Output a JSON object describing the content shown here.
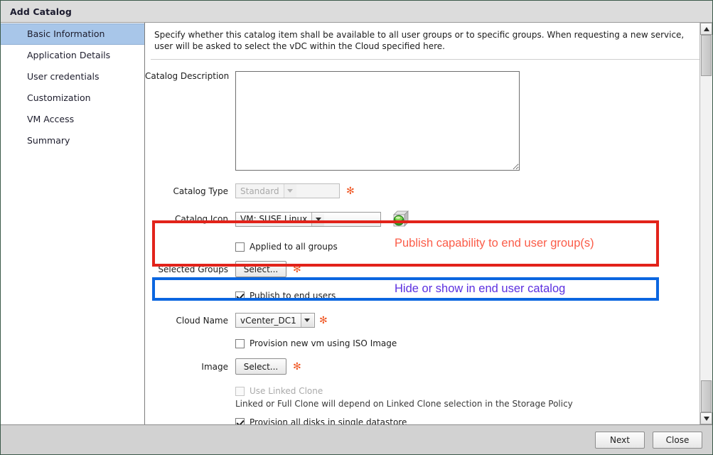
{
  "window": {
    "title": "Add Catalog"
  },
  "sidebar": {
    "items": [
      {
        "label": "Basic Information",
        "active": true
      },
      {
        "label": "Application Details",
        "active": false
      },
      {
        "label": "User credentials",
        "active": false
      },
      {
        "label": "Customization",
        "active": false
      },
      {
        "label": "VM Access",
        "active": false
      },
      {
        "label": "Summary",
        "active": false
      }
    ]
  },
  "intro": {
    "text": "Specify whether this catalog item shall be available to all user groups or to specific groups.  When requesting a new service, user will be asked to select the vDC within the Cloud specified here."
  },
  "form": {
    "catalog_description": {
      "label": "Catalog Description",
      "value": "",
      "placeholder": ""
    },
    "catalog_type": {
      "label": "Catalog Type",
      "value": "Standard",
      "disabled": true,
      "required_mark": "✻"
    },
    "catalog_icon": {
      "label": "Catalog Icon",
      "value": "VM: SUSE Linux",
      "preview_icon": "vm-cube-icon"
    },
    "applied_to_all_groups": {
      "label": "Applied to all groups",
      "checked": false
    },
    "selected_groups": {
      "label": "Selected Groups",
      "button_label": "Select...",
      "required_mark": "✻"
    },
    "publish_to_end_users": {
      "label": "Publish to end users",
      "checked": true
    },
    "cloud_name": {
      "label": "Cloud Name",
      "value": "vCenter_DC1",
      "required_mark": "✻"
    },
    "provision_iso": {
      "label": "Provision new vm using ISO Image",
      "checked": false
    },
    "image": {
      "label": "Image",
      "button_label": "Select...",
      "required_mark": "✻"
    },
    "use_linked_clone": {
      "label": "Use Linked Clone",
      "checked": false,
      "disabled": true
    },
    "linked_clone_help": {
      "text": "Linked or Full Clone will depend on Linked Clone selection in the Storage Policy"
    },
    "provision_single_datastore": {
      "label": "Provision all disks in single datastore",
      "checked": true
    }
  },
  "annotations": [
    {
      "text": "Publish capability to end user group(s)",
      "border_color": "#e2231a",
      "text_color": "#fb5c48"
    },
    {
      "text": "Hide or show in end user catalog",
      "border_color": "#0b66e0",
      "text_color": "#5b2fe0"
    }
  ],
  "footer": {
    "next_label": "Next",
    "close_label": "Close"
  }
}
